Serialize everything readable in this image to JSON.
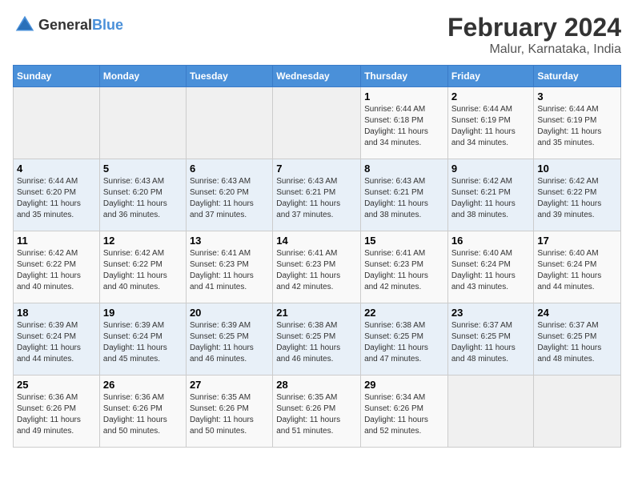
{
  "header": {
    "logo_general": "General",
    "logo_blue": "Blue",
    "title": "February 2024",
    "subtitle": "Malur, Karnataka, India"
  },
  "days_of_week": [
    "Sunday",
    "Monday",
    "Tuesday",
    "Wednesday",
    "Thursday",
    "Friday",
    "Saturday"
  ],
  "weeks": [
    [
      {
        "day": "",
        "info": ""
      },
      {
        "day": "",
        "info": ""
      },
      {
        "day": "",
        "info": ""
      },
      {
        "day": "",
        "info": ""
      },
      {
        "day": "1",
        "info": "Sunrise: 6:44 AM\nSunset: 6:18 PM\nDaylight: 11 hours\nand 34 minutes."
      },
      {
        "day": "2",
        "info": "Sunrise: 6:44 AM\nSunset: 6:19 PM\nDaylight: 11 hours\nand 34 minutes."
      },
      {
        "day": "3",
        "info": "Sunrise: 6:44 AM\nSunset: 6:19 PM\nDaylight: 11 hours\nand 35 minutes."
      }
    ],
    [
      {
        "day": "4",
        "info": "Sunrise: 6:44 AM\nSunset: 6:20 PM\nDaylight: 11 hours\nand 35 minutes."
      },
      {
        "day": "5",
        "info": "Sunrise: 6:43 AM\nSunset: 6:20 PM\nDaylight: 11 hours\nand 36 minutes."
      },
      {
        "day": "6",
        "info": "Sunrise: 6:43 AM\nSunset: 6:20 PM\nDaylight: 11 hours\nand 37 minutes."
      },
      {
        "day": "7",
        "info": "Sunrise: 6:43 AM\nSunset: 6:21 PM\nDaylight: 11 hours\nand 37 minutes."
      },
      {
        "day": "8",
        "info": "Sunrise: 6:43 AM\nSunset: 6:21 PM\nDaylight: 11 hours\nand 38 minutes."
      },
      {
        "day": "9",
        "info": "Sunrise: 6:42 AM\nSunset: 6:21 PM\nDaylight: 11 hours\nand 38 minutes."
      },
      {
        "day": "10",
        "info": "Sunrise: 6:42 AM\nSunset: 6:22 PM\nDaylight: 11 hours\nand 39 minutes."
      }
    ],
    [
      {
        "day": "11",
        "info": "Sunrise: 6:42 AM\nSunset: 6:22 PM\nDaylight: 11 hours\nand 40 minutes."
      },
      {
        "day": "12",
        "info": "Sunrise: 6:42 AM\nSunset: 6:22 PM\nDaylight: 11 hours\nand 40 minutes."
      },
      {
        "day": "13",
        "info": "Sunrise: 6:41 AM\nSunset: 6:23 PM\nDaylight: 11 hours\nand 41 minutes."
      },
      {
        "day": "14",
        "info": "Sunrise: 6:41 AM\nSunset: 6:23 PM\nDaylight: 11 hours\nand 42 minutes."
      },
      {
        "day": "15",
        "info": "Sunrise: 6:41 AM\nSunset: 6:23 PM\nDaylight: 11 hours\nand 42 minutes."
      },
      {
        "day": "16",
        "info": "Sunrise: 6:40 AM\nSunset: 6:24 PM\nDaylight: 11 hours\nand 43 minutes."
      },
      {
        "day": "17",
        "info": "Sunrise: 6:40 AM\nSunset: 6:24 PM\nDaylight: 11 hours\nand 44 minutes."
      }
    ],
    [
      {
        "day": "18",
        "info": "Sunrise: 6:39 AM\nSunset: 6:24 PM\nDaylight: 11 hours\nand 44 minutes."
      },
      {
        "day": "19",
        "info": "Sunrise: 6:39 AM\nSunset: 6:24 PM\nDaylight: 11 hours\nand 45 minutes."
      },
      {
        "day": "20",
        "info": "Sunrise: 6:39 AM\nSunset: 6:25 PM\nDaylight: 11 hours\nand 46 minutes."
      },
      {
        "day": "21",
        "info": "Sunrise: 6:38 AM\nSunset: 6:25 PM\nDaylight: 11 hours\nand 46 minutes."
      },
      {
        "day": "22",
        "info": "Sunrise: 6:38 AM\nSunset: 6:25 PM\nDaylight: 11 hours\nand 47 minutes."
      },
      {
        "day": "23",
        "info": "Sunrise: 6:37 AM\nSunset: 6:25 PM\nDaylight: 11 hours\nand 48 minutes."
      },
      {
        "day": "24",
        "info": "Sunrise: 6:37 AM\nSunset: 6:25 PM\nDaylight: 11 hours\nand 48 minutes."
      }
    ],
    [
      {
        "day": "25",
        "info": "Sunrise: 6:36 AM\nSunset: 6:26 PM\nDaylight: 11 hours\nand 49 minutes."
      },
      {
        "day": "26",
        "info": "Sunrise: 6:36 AM\nSunset: 6:26 PM\nDaylight: 11 hours\nand 50 minutes."
      },
      {
        "day": "27",
        "info": "Sunrise: 6:35 AM\nSunset: 6:26 PM\nDaylight: 11 hours\nand 50 minutes."
      },
      {
        "day": "28",
        "info": "Sunrise: 6:35 AM\nSunset: 6:26 PM\nDaylight: 11 hours\nand 51 minutes."
      },
      {
        "day": "29",
        "info": "Sunrise: 6:34 AM\nSunset: 6:26 PM\nDaylight: 11 hours\nand 52 minutes."
      },
      {
        "day": "",
        "info": ""
      },
      {
        "day": "",
        "info": ""
      }
    ]
  ]
}
